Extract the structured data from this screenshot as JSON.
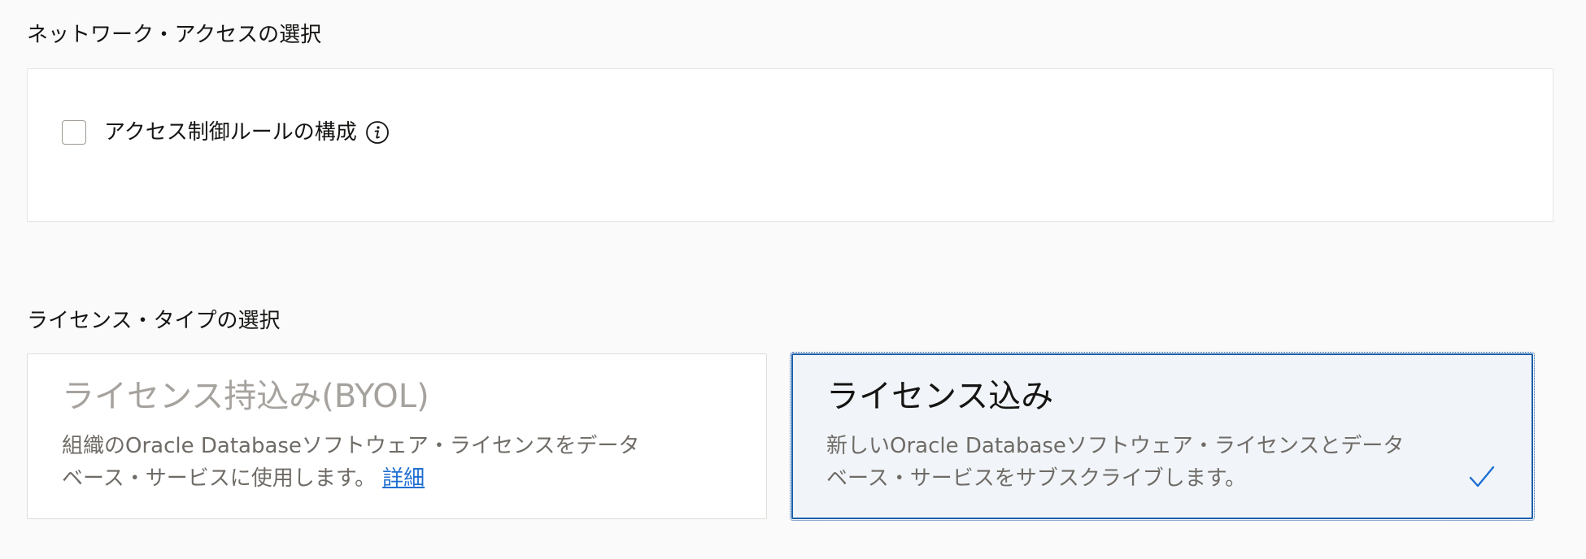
{
  "network_access": {
    "heading": "ネットワーク・アクセスの選択",
    "access_control": {
      "label": "アクセス制御ルールの構成",
      "checked": false
    }
  },
  "license_type": {
    "heading": "ライセンス・タイプの選択",
    "options": [
      {
        "title": "ライセンス持込み(BYOL)",
        "description_line1": "組織のOracle Databaseソフトウェア・ライセンスをデータ",
        "description_line2": "ベース・サービスに使用します。",
        "link_text": "詳細",
        "selected": false
      },
      {
        "title": "ライセンス込み",
        "description_line1": "新しいOracle Databaseソフトウェア・ライセンスとデータ",
        "description_line2": "ベース・サービスをサブスクライブします。",
        "selected": true
      }
    ]
  },
  "colors": {
    "accent": "#1a5ea8",
    "link": "#1f6fd1",
    "selected_background": "#f1f5fa"
  },
  "icons": {
    "info": "info-icon",
    "selected_check": "checkmark-icon"
  }
}
